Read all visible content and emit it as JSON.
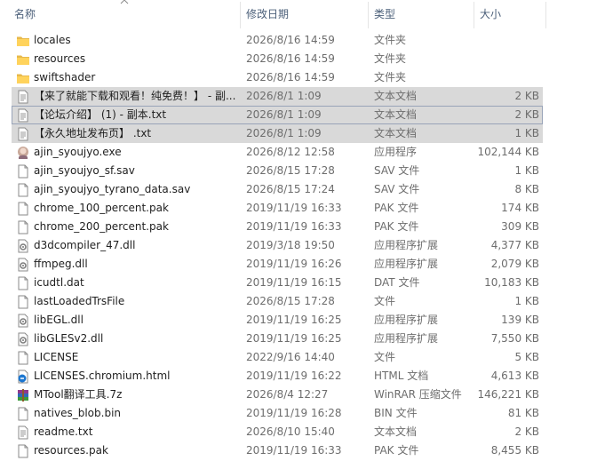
{
  "header": {
    "name": "名称",
    "date": "修改日期",
    "type": "类型",
    "size": "大小"
  },
  "rows": [
    {
      "name": "locales",
      "date": "2026/8/16 14:59",
      "type": "文件夹",
      "size": "",
      "icon": "folder-icon"
    },
    {
      "name": "resources",
      "date": "2026/8/16 14:59",
      "type": "文件夹",
      "size": "",
      "icon": "folder-icon"
    },
    {
      "name": "swiftshader",
      "date": "2026/8/16 14:59",
      "type": "文件夹",
      "size": "",
      "icon": "folder-icon"
    },
    {
      "name": "【来了就能下载和观看！纯免费！】 - 副...",
      "date": "2026/8/1 1:09",
      "type": "文本文档",
      "size": "2 KB",
      "icon": "text-file-icon",
      "selected": true
    },
    {
      "name": "【论坛介绍】 (1) - 副本.txt",
      "date": "2026/8/1 1:09",
      "type": "文本文档",
      "size": "2 KB",
      "icon": "text-file-icon",
      "selected": true,
      "focused": true
    },
    {
      "name": "【永久地址发布页】 .txt",
      "date": "2026/8/1 1:09",
      "type": "文本文档",
      "size": "1 KB",
      "icon": "text-file-icon",
      "selected": true
    },
    {
      "name": "ajin_syoujyo.exe",
      "date": "2026/8/12 12:58",
      "type": "应用程序",
      "size": "102,144 KB",
      "icon": "app-icon"
    },
    {
      "name": "ajin_syoujyo_sf.sav",
      "date": "2026/8/15 17:28",
      "type": "SAV 文件",
      "size": "1 KB",
      "icon": "file-icon"
    },
    {
      "name": "ajin_syoujyo_tyrano_data.sav",
      "date": "2026/8/15 17:24",
      "type": "SAV 文件",
      "size": "8 KB",
      "icon": "file-icon"
    },
    {
      "name": "chrome_100_percent.pak",
      "date": "2019/11/19 16:33",
      "type": "PAK 文件",
      "size": "174 KB",
      "icon": "file-icon"
    },
    {
      "name": "chrome_200_percent.pak",
      "date": "2019/11/19 16:33",
      "type": "PAK 文件",
      "size": "309 KB",
      "icon": "file-icon"
    },
    {
      "name": "d3dcompiler_47.dll",
      "date": "2019/3/18 19:50",
      "type": "应用程序扩展",
      "size": "4,377 KB",
      "icon": "dll-icon"
    },
    {
      "name": "ffmpeg.dll",
      "date": "2019/11/19 16:26",
      "type": "应用程序扩展",
      "size": "2,079 KB",
      "icon": "dll-icon"
    },
    {
      "name": "icudtl.dat",
      "date": "2019/11/19 16:15",
      "type": "DAT 文件",
      "size": "10,183 KB",
      "icon": "file-icon"
    },
    {
      "name": "lastLoadedTrsFile",
      "date": "2026/8/15 17:28",
      "type": "文件",
      "size": "1 KB",
      "icon": "file-icon"
    },
    {
      "name": "libEGL.dll",
      "date": "2019/11/19 16:25",
      "type": "应用程序扩展",
      "size": "139 KB",
      "icon": "dll-icon"
    },
    {
      "name": "libGLESv2.dll",
      "date": "2019/11/19 16:25",
      "type": "应用程序扩展",
      "size": "7,550 KB",
      "icon": "dll-icon"
    },
    {
      "name": "LICENSE",
      "date": "2022/9/16 14:40",
      "type": "文件",
      "size": "5 KB",
      "icon": "file-icon"
    },
    {
      "name": "LICENSES.chromium.html",
      "date": "2019/11/19 16:22",
      "type": "HTML 文档",
      "size": "4,613 KB",
      "icon": "edge-html-icon"
    },
    {
      "name": "MTool翻译工具.7z",
      "date": "2026/8/4 12:27",
      "type": "WinRAR 压缩文件",
      "size": "146,221 KB",
      "icon": "winrar-icon"
    },
    {
      "name": "natives_blob.bin",
      "date": "2019/11/19 16:28",
      "type": "BIN 文件",
      "size": "81 KB",
      "icon": "file-icon"
    },
    {
      "name": "readme.txt",
      "date": "2026/8/10 15:40",
      "type": "文本文档",
      "size": "2 KB",
      "icon": "text-file-icon"
    },
    {
      "name": "resources.pak",
      "date": "2019/11/19 16:33",
      "type": "PAK 文件",
      "size": "8,455 KB",
      "icon": "file-icon"
    }
  ]
}
